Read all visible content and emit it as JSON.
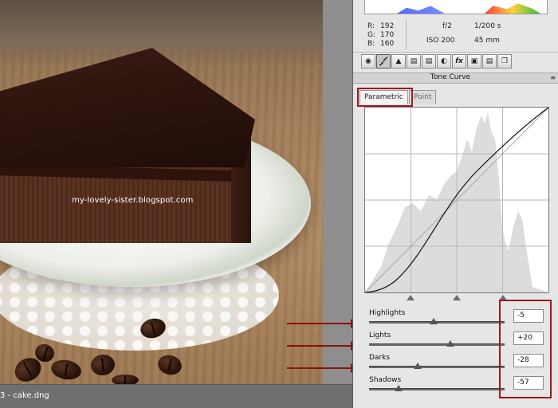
{
  "photo": {
    "watermark": "my-lovely-sister.blogspot.com"
  },
  "status": {
    "text": "3  -  cake.dng"
  },
  "info": {
    "rgb": [
      {
        "label": "R:",
        "value": "192"
      },
      {
        "label": "G:",
        "value": "170"
      },
      {
        "label": "B:",
        "value": "160"
      }
    ],
    "fstop": "f/2",
    "shutter": "1/200 s",
    "iso": "ISO 200",
    "focal": "45 mm"
  },
  "panel_tabs": [
    "basic-icon",
    "tone-curve-icon",
    "detail-icon",
    "hsl-icon",
    "split-toning-icon",
    "lens-icon",
    "effects-icon",
    "camera-calibration-icon",
    "presets-icon",
    "snapshots-icon"
  ],
  "section": {
    "title": "Tone Curve",
    "menu": "≡"
  },
  "subtabs": {
    "parametric": "Parametric",
    "point": "Point"
  },
  "sliders": [
    {
      "label": "Highlights",
      "value": "-5",
      "level": -5
    },
    {
      "label": "Lights",
      "value": "+20",
      "level": 20
    },
    {
      "label": "Darks",
      "value": "-28",
      "level": -28
    },
    {
      "label": "Shadows",
      "value": "-57",
      "level": -57
    }
  ],
  "colors": {
    "annotation": "#a01818",
    "panel_bg": "#e6e6e6"
  }
}
